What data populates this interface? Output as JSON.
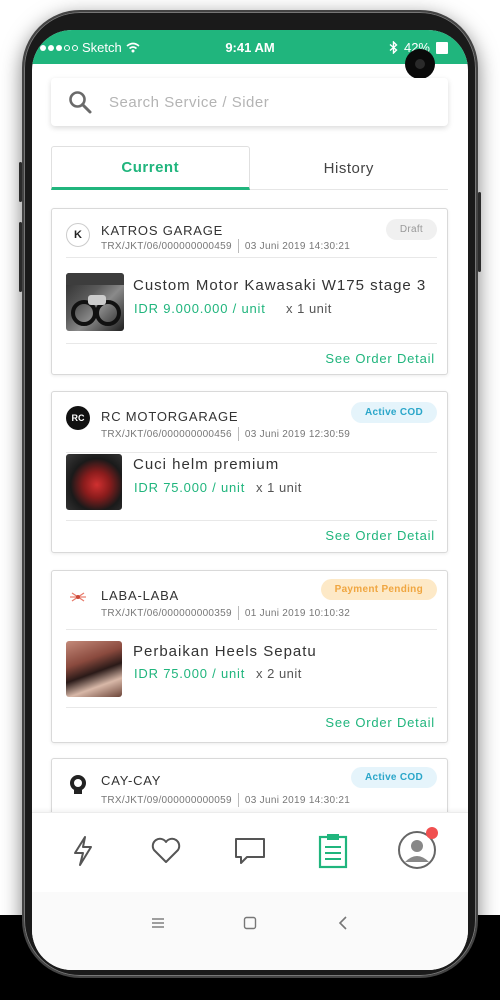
{
  "status_bar": {
    "carrier": "Sketch",
    "time": "9:41 AM",
    "battery": "42%"
  },
  "search": {
    "placeholder": "Search Service / Sider"
  },
  "tabs": [
    {
      "label": "Current",
      "active": true
    },
    {
      "label": "History",
      "active": false
    }
  ],
  "orders": [
    {
      "garage": "KATROS GARAGE",
      "trx": "TRX/JKT/06/000000000459",
      "date": "03 Juni 2019 14:30:21",
      "status": "Draft",
      "item": "Custom Motor Kawasaki W175 stage 3",
      "price": "IDR 9.000.000 / unit",
      "qty": "x 1 unit",
      "detail_link": "See Order Detail"
    },
    {
      "garage": "RC MOTORGARAGE",
      "trx": "TRX/JKT/06/000000000456",
      "date": "03 Juni 2019 12:30:59",
      "status": "Active COD",
      "item": "Cuci helm premium",
      "price": "IDR 75.000 / unit",
      "qty": "x 1 unit",
      "detail_link": "See Order Detail"
    },
    {
      "garage": "LABA-LABA",
      "trx": "TRX/JKT/06/000000000359",
      "date": "01 Juni 2019 10:10:32",
      "status": "Payment Pending",
      "item": "Perbaikan Heels Sepatu",
      "price": "IDR 75.000 / unit",
      "qty": "x 2 unit",
      "detail_link": "See Order Detail"
    },
    {
      "garage": "CAY-CAY",
      "trx": "TRX/JKT/09/000000000059",
      "date": "03 Juni 2019 14:30:21",
      "status": "Active COD"
    }
  ],
  "logo_text": {
    "katros": "K",
    "rc": "RC"
  },
  "nav": [
    {
      "icon": "bolt-icon"
    },
    {
      "icon": "heart-icon"
    },
    {
      "icon": "chat-icon"
    },
    {
      "icon": "orders-icon",
      "active": true
    },
    {
      "icon": "profile-icon",
      "notification": true
    }
  ],
  "system_buttons": {
    "recent": "|||",
    "home": "□",
    "back": "<"
  },
  "colors": {
    "accent": "#20b57d",
    "status_cod": "#2aa6c9",
    "status_pending": "#f0a640",
    "status_draft": "#999999",
    "notification": "#f05050"
  }
}
